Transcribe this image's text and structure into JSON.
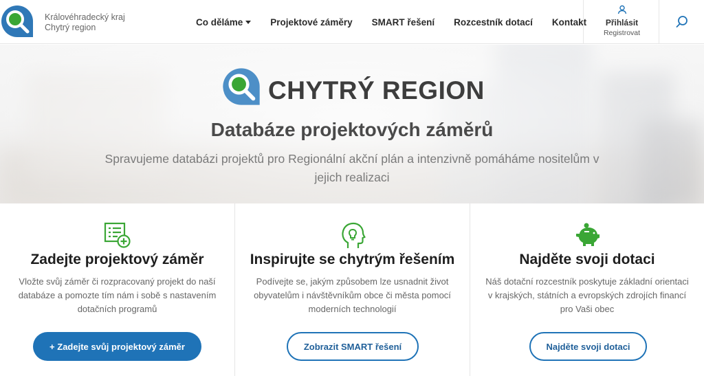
{
  "header": {
    "brand_line1": "Královéhradecký kraj",
    "brand_line2": "Chytrý region",
    "nav": [
      {
        "label": "Co děláme",
        "has_dropdown": true
      },
      {
        "label": "Projektové záměry"
      },
      {
        "label": "SMART řešení"
      },
      {
        "label": "Rozcestník dotací"
      },
      {
        "label": "Kontakt"
      }
    ],
    "login_label": "Přihlásit",
    "register_label": "Registrovat",
    "icons": {
      "user": "user-icon",
      "search": "search-icon"
    }
  },
  "hero": {
    "brand": "CHYTRÝ REGION",
    "title": "Databáze projektových záměrů",
    "subtitle": "Spravujeme databázi projektů pro Regionální akční plán a intenzivně pomáháme nositelům v jejich realizaci"
  },
  "cards": [
    {
      "icon": "form-add-icon",
      "title": "Zadejte projektový záměr",
      "description": "Vložte svůj záměr či rozpracovaný projekt do naší databáze a pomozte tím nám i sobě s nastavením dotačních programů",
      "button": "+ Zadejte svůj projektový záměr"
    },
    {
      "icon": "head-bulb-icon",
      "title": "Inspirujte se chytrým řešením",
      "description": "Podívejte se, jakým způsobem lze usnadnit život obyvatelům i návštěvníkům obce či města pomocí moderních technologií",
      "button": "Zobrazit SMART řešení"
    },
    {
      "icon": "piggy-bank-icon",
      "title": "Najděte svoji dotaci",
      "description": "Náš dotační rozcestník poskytuje základní orientaci v krajských, státních a evropských zdrojích financí pro Vaši obec",
      "button": "Najděte svoji dotaci"
    }
  ],
  "colors": {
    "accent_green": "#3aa635",
    "brand_blue": "#1f73b7",
    "logo_blue": "#2f78b7"
  }
}
